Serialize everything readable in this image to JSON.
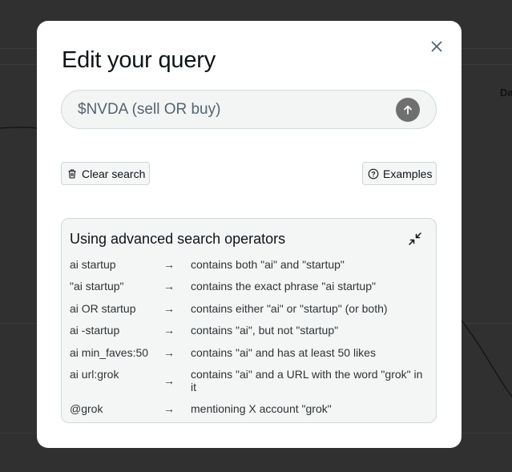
{
  "background": {
    "partial_label": "Da"
  },
  "modal": {
    "title": "Edit your query",
    "close_icon": "close-icon",
    "query": {
      "value": "$NVDA (sell OR buy)",
      "submit_icon": "arrow-up-icon"
    },
    "actions": {
      "clear_label": "Clear search",
      "clear_icon": "trash-icon",
      "examples_label": "Examples",
      "examples_icon": "question-circle-icon"
    },
    "operators": {
      "title": "Using advanced search operators",
      "collapse_icon": "collapse-icon",
      "arrow": "→",
      "rows": [
        {
          "operator": "ai startup",
          "description": "contains both \"ai\" and \"startup\""
        },
        {
          "operator": "\"ai startup\"",
          "description": "contains the exact phrase \"ai startup\""
        },
        {
          "operator": "ai OR startup",
          "description": "contains either \"ai\" or \"startup\" (or both)"
        },
        {
          "operator": "ai -startup",
          "description": "contains \"ai\", but not \"startup\""
        },
        {
          "operator": "ai min_faves:50",
          "description": "contains \"ai\" and has at least 50 likes"
        },
        {
          "operator": "ai url:grok",
          "description": "contains \"ai\" and a URL with the word \"grok\" in it"
        },
        {
          "operator": "@grok",
          "description": "mentioning X account \"grok\""
        }
      ]
    }
  }
}
